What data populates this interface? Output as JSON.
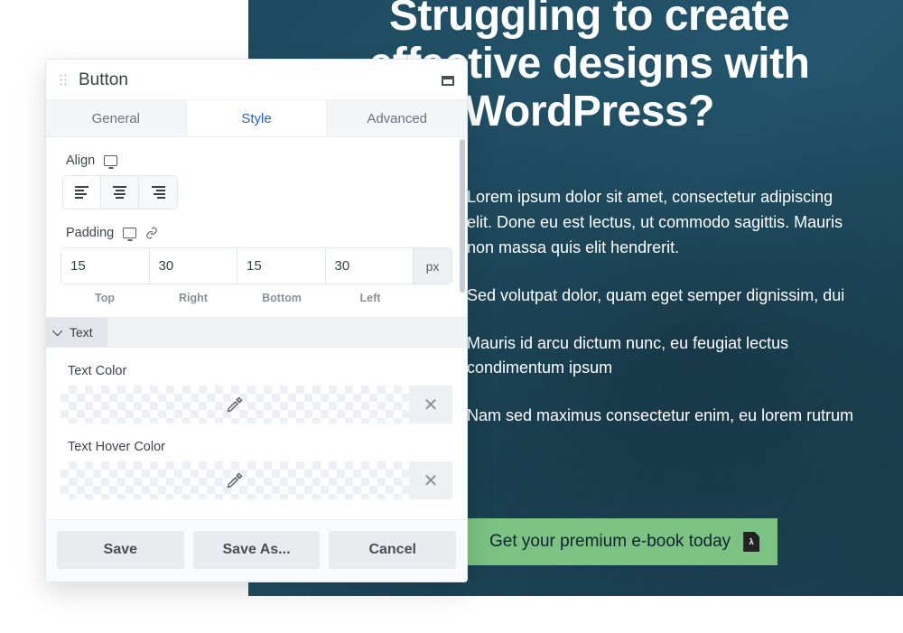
{
  "hero": {
    "title": "Struggling to create effective designs with WordPress?",
    "para1": "Lorem ipsum dolor sit amet, consectetur adipiscing elit. Done eu est lectus, ut commodo sagittis. Mauris non massa quis elit hendrerit.",
    "list1": "Sed volutpat dolor, quam eget semper dignissim, dui",
    "list2": "Mauris id arcu dictum nunc, eu feugiat lectus condimentum ipsum",
    "list3": "Nam sed maximus consectetur enim, eu lorem  rutrum",
    "cta_label": "Get your premium e-book today"
  },
  "panel": {
    "title": "Button",
    "tabs": {
      "general": "General",
      "style": "Style",
      "advanced": "Advanced"
    },
    "align_label": "Align",
    "padding_label": "Padding",
    "padding": {
      "top": "15",
      "right": "30",
      "bottom": "15",
      "left": "30",
      "unit": "px"
    },
    "pad_labels": {
      "top": "Top",
      "right": "Right",
      "bottom": "Bottom",
      "left": "Left"
    },
    "text_section": "Text",
    "text_color_label": "Text Color",
    "text_hover_color_label": "Text Hover Color",
    "clear_glyph": "✕",
    "footer": {
      "save": "Save",
      "save_as": "Save As...",
      "cancel": "Cancel"
    }
  }
}
